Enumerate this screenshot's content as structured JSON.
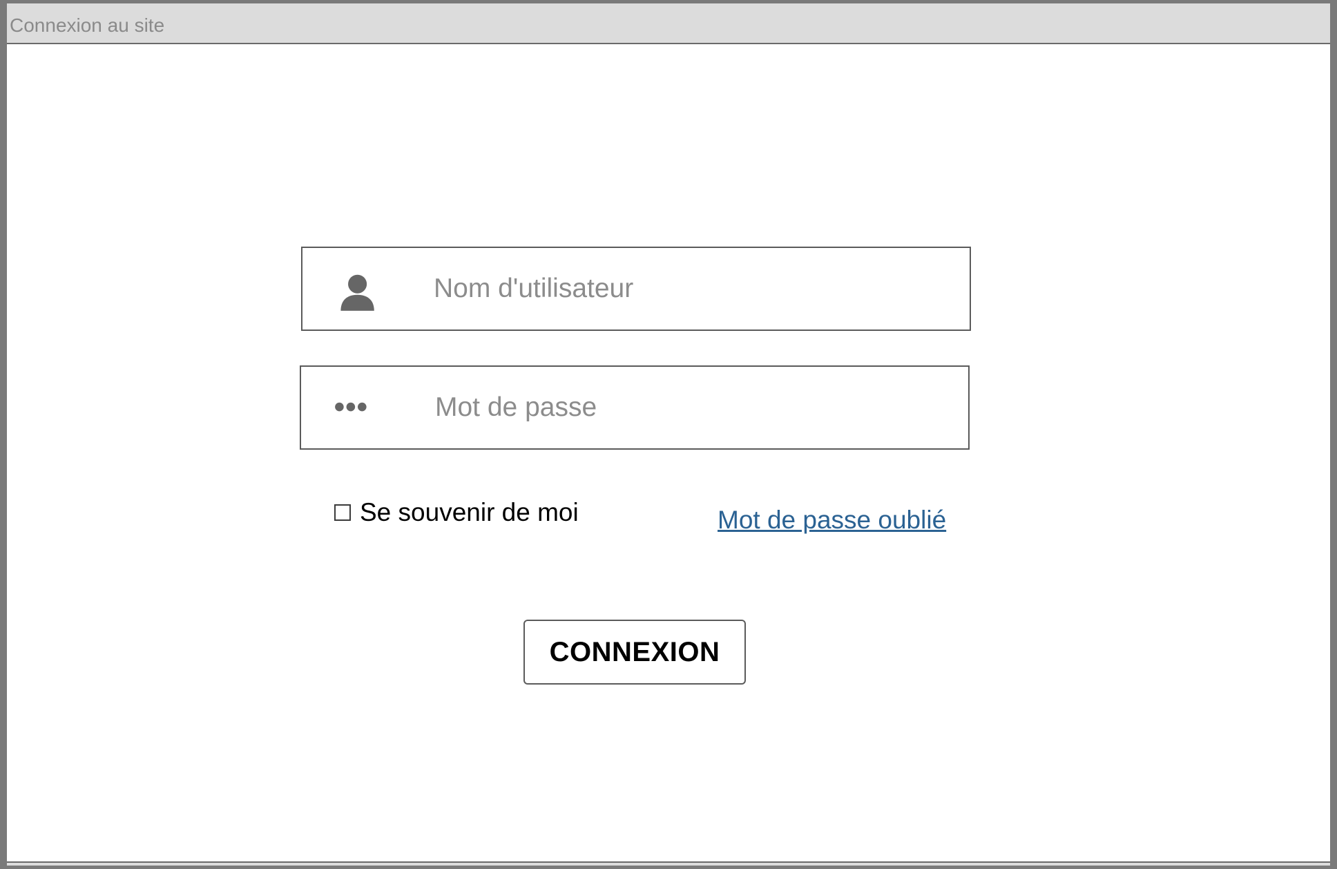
{
  "window": {
    "title": "Connexion au site"
  },
  "login_form": {
    "username": {
      "icon": "user-icon",
      "placeholder": "Nom d'utilisateur",
      "value": ""
    },
    "password": {
      "icon": "dots-icon",
      "placeholder": "Mot de passe",
      "value": ""
    },
    "remember_me": {
      "label": "Se souvenir de moi",
      "checked": false
    },
    "forgot_password": {
      "label": "Mot de passe oublié"
    },
    "submit": {
      "label": "CONNEXION"
    }
  },
  "colors": {
    "link": "#2b6293",
    "placeholder": "#8c8c8c",
    "titlebar_bg": "#dcdcdc",
    "border": "#5a5a5a",
    "icon": "#666666"
  }
}
